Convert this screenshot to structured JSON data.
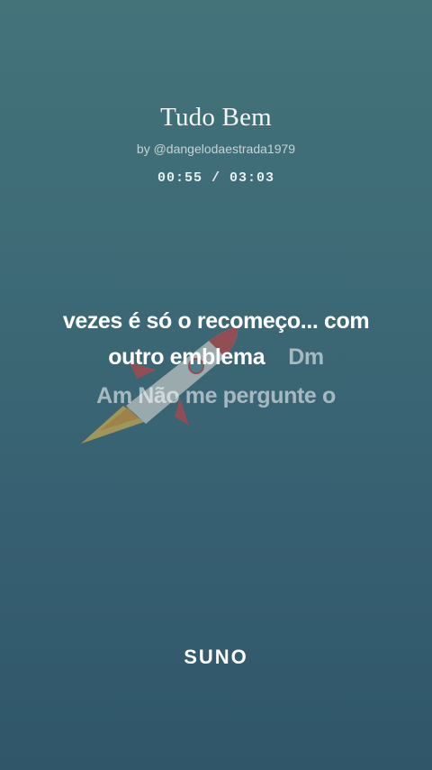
{
  "song": {
    "title": "Tudo Bem",
    "byline": "by @dangelodaestrada1979",
    "time": "00:55 / 03:03"
  },
  "lyrics": {
    "line1": "vezes é só o recomeço... com",
    "line2": "outro emblema",
    "line2_chord": "Dm",
    "line3": "Am Não me pergunte o"
  },
  "brand": {
    "logo": "SUNO"
  },
  "colors": {
    "background_top": "#44737a",
    "background_bottom": "#2f5769",
    "text": "#ffffff"
  },
  "icons": {
    "background_art": "rocket-icon"
  }
}
